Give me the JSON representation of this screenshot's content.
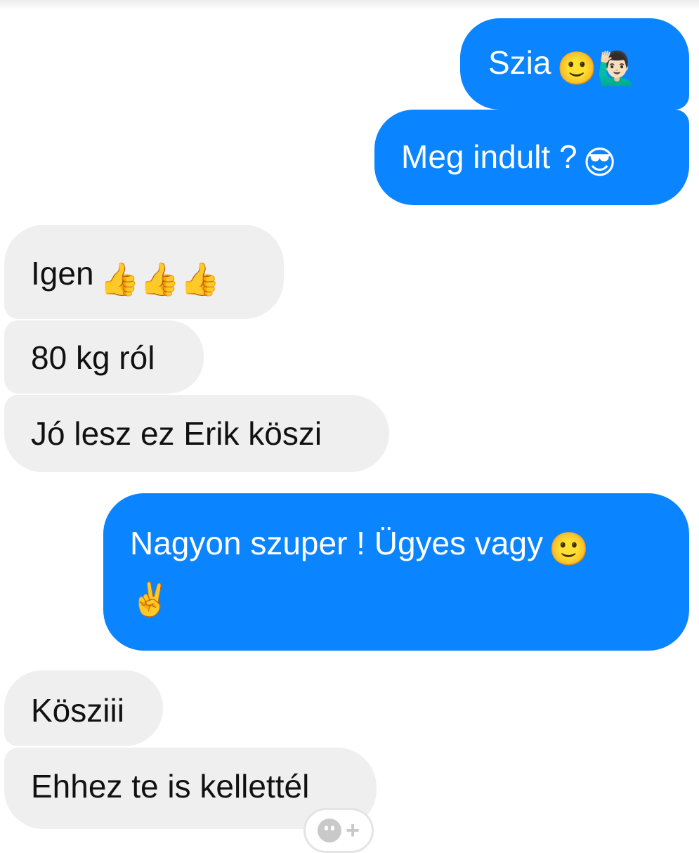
{
  "conversation": {
    "messages": [
      {
        "direction": "outgoing",
        "text": "Szia",
        "emoji": "🙂🙋🏻‍♂️"
      },
      {
        "direction": "outgoing",
        "text": "Meg indult ?",
        "emoji": "😎"
      },
      {
        "direction": "incoming",
        "text": "Igen",
        "emoji": "👍👍👍"
      },
      {
        "direction": "incoming",
        "text": "80 kg ról",
        "emoji": ""
      },
      {
        "direction": "incoming",
        "text": "Jó lesz ez Erik köszi",
        "emoji": ""
      },
      {
        "direction": "outgoing",
        "text": "Nagyon szuper ! Ügyes vagy",
        "emoji": "🙂",
        "emoji_line2": "✌️"
      },
      {
        "direction": "incoming",
        "text": "Köszi​ii",
        "emoji": ""
      },
      {
        "direction": "incoming",
        "text": "Ehhez te is kellettél",
        "emoji": ""
      }
    ],
    "reaction_button": {
      "icon": "add-reaction-icon",
      "plus": "+"
    }
  },
  "colors": {
    "outgoing_bubble": "#0a84ff",
    "incoming_bubble": "#efefef",
    "outgoing_text": "#ffffff",
    "incoming_text": "#111111"
  }
}
